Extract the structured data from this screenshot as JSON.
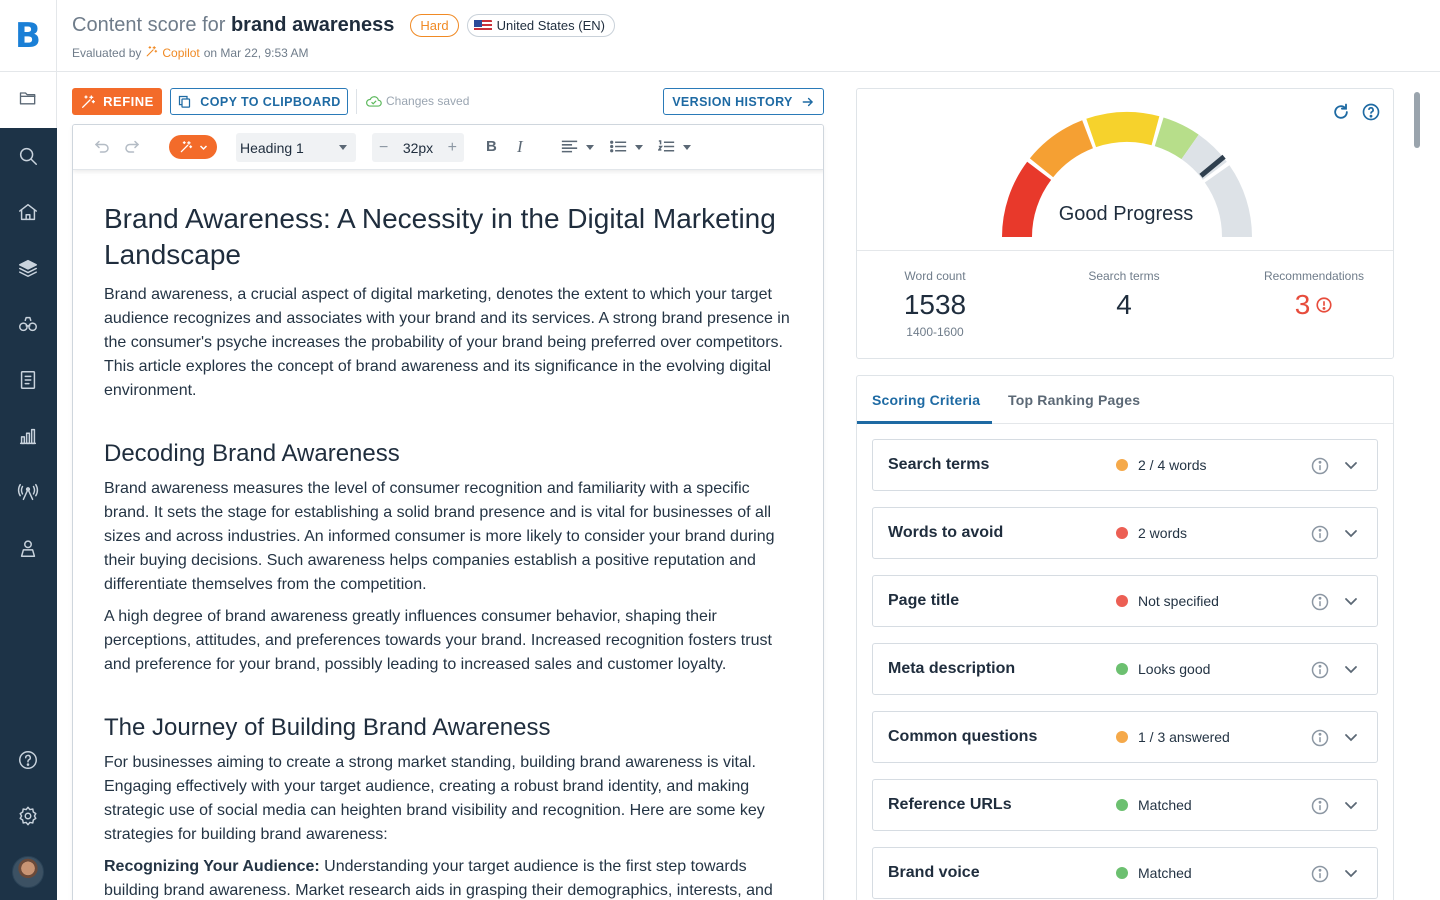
{
  "app": {
    "logo": "B"
  },
  "header": {
    "title_prefix": "Content score for ",
    "title_keyword": "brand awareness",
    "difficulty_badge": "Hard",
    "locale_badge": "United States (EN)",
    "evaluated_by_label": "Evaluated by",
    "evaluator": "Copilot",
    "evaluated_on": "on Mar 22, 9:53 AM"
  },
  "sidebar": {
    "items": [
      {
        "icon": "folder-icon"
      },
      {
        "icon": "search-icon"
      },
      {
        "icon": "home-icon"
      },
      {
        "icon": "layers-icon"
      },
      {
        "icon": "binoculars-icon"
      },
      {
        "icon": "document-icon"
      },
      {
        "icon": "chart-icon"
      },
      {
        "icon": "signal-icon"
      },
      {
        "icon": "user-pin-icon"
      }
    ],
    "bottom": [
      {
        "icon": "help-icon"
      },
      {
        "icon": "settings-icon"
      },
      {
        "icon": "avatar"
      }
    ]
  },
  "toolbar": {
    "refine_label": "REFINE",
    "copy_label": "COPY TO CLIPBOARD",
    "saved_label": "Changes saved",
    "version_label": "VERSION HISTORY"
  },
  "editor_toolbar": {
    "text_style": "Heading 1",
    "font_size": "32px"
  },
  "document": {
    "h1": "Brand Awareness: A Necessity in the Digital Marketing Landscape",
    "p1": "Brand awareness, a crucial aspect of digital marketing, denotes the extent to which your target audience recognizes and associates with your brand and its services. A strong brand presence in the consumer's psyche increases the probability of your brand being preferred over competitors. This article explores the concept of brand awareness and its significance in the evolving digital environment.",
    "h2a": "Decoding Brand Awareness",
    "p2": "Brand awareness measures the level of consumer recognition and familiarity with a specific brand. It sets the stage for establishing a solid brand presence and is vital for businesses of all sizes and across industries. An informed consumer is more likely to consider your brand during their buying decisions. Such awareness helps companies establish a positive reputation and differentiate themselves from the competition.",
    "p3": "A high degree of brand awareness greatly influences consumer behavior, shaping their perceptions, attitudes, and preferences towards your brand. Increased recognition fosters trust and preference for your brand, possibly leading to increased sales and customer loyalty.",
    "h2b": "The Journey of Building Brand Awareness",
    "p4": "For businesses aiming to create a strong market standing, building brand awareness is vital. Engaging effectively with your target audience, creating a robust brand identity, and making strategic use of social media can heighten brand visibility and recognition. Here are some key strategies for building brand awareness:",
    "p5_bold": "Recognizing Your Audience:",
    "p5_rest": " Understanding your target audience is the first step towards building brand awareness. Market research aids in grasping their demographics, interests, and"
  },
  "score": {
    "label": "Good Progress",
    "gauge_value": 0.78,
    "colors": {
      "red": "#e8392b",
      "orange": "#f5a033",
      "yellow": "#f6d22c",
      "green": "#b7de8a",
      "gray": "#dde2e7"
    },
    "word_count_label": "Word count",
    "word_count": "1538",
    "word_count_range": "1400-1600",
    "search_terms_label": "Search terms",
    "search_terms": "4",
    "recommendations_label": "Recommendations",
    "recommendations": "3"
  },
  "tabs": [
    {
      "label": "Scoring Criteria",
      "active": true
    },
    {
      "label": "Top Ranking Pages",
      "active": false
    }
  ],
  "criteria": [
    {
      "name": "Search terms",
      "status": "2 / 4 words",
      "color": "#f5a94a"
    },
    {
      "name": "Words to avoid",
      "status": "2 words",
      "color": "#ec5f54"
    },
    {
      "name": "Page title",
      "status": "Not specified",
      "color": "#ec5f54"
    },
    {
      "name": "Meta description",
      "status": "Looks good",
      "color": "#6cc070"
    },
    {
      "name": "Common questions",
      "status": "1 / 3 answered",
      "color": "#f5a94a"
    },
    {
      "name": "Reference URLs",
      "status": "Matched",
      "color": "#6cc070"
    },
    {
      "name": "Brand voice",
      "status": "Matched",
      "color": "#6cc070"
    }
  ]
}
